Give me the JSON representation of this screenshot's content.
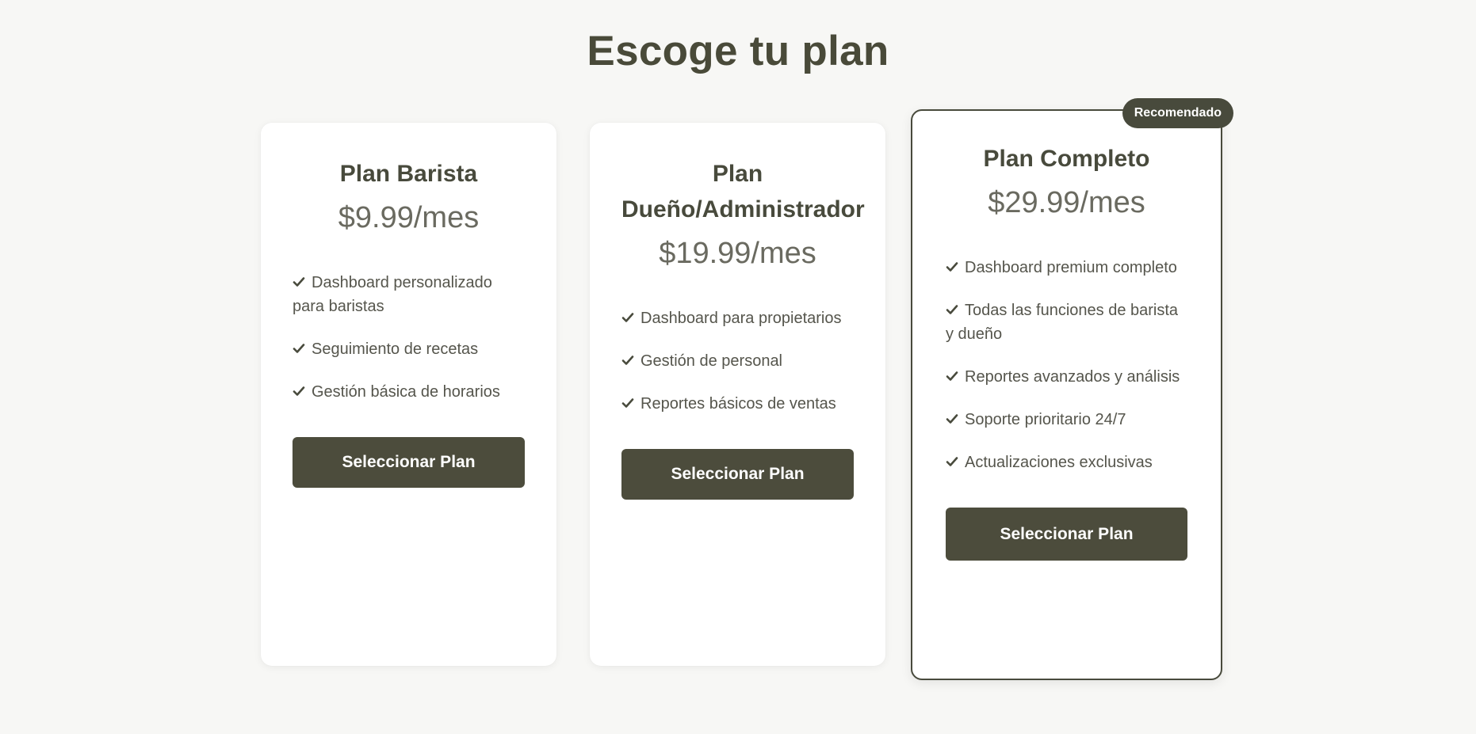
{
  "page": {
    "title": "Escoge tu plan"
  },
  "colors": {
    "background": "#f7f7f5",
    "accent": "#484a3c",
    "button": "#4c4c3c",
    "price": "#6a6a60"
  },
  "plans": [
    {
      "name": "Plan Barista",
      "price": "$9.99/mes",
      "features": [
        "Dashboard personalizado para baristas",
        "Seguimiento de recetas",
        "Gestión básica de horarios"
      ],
      "button_label": "Seleccionar Plan"
    },
    {
      "name": "Plan Dueño/Administrador",
      "price": "$19.99/mes",
      "features": [
        "Dashboard para propietarios",
        "Gestión de personal",
        "Reportes básicos de ventas"
      ],
      "button_label": "Seleccionar Plan"
    },
    {
      "name": "Plan Completo",
      "price": "$29.99/mes",
      "badge": "Recomendado",
      "features": [
        "Dashboard premium completo",
        "Todas las funciones de barista y dueño",
        "Reportes avanzados y análisis",
        "Soporte prioritario 24/7",
        "Actualizaciones exclusivas"
      ],
      "button_label": "Seleccionar Plan"
    }
  ],
  "icons": {
    "feature_check": "check-icon"
  }
}
